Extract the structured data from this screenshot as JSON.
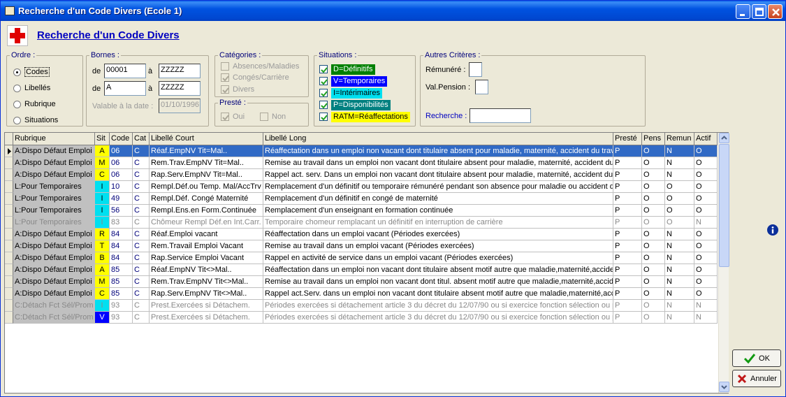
{
  "window": {
    "title": "Recherche d'un Code Divers (Ecole 1)"
  },
  "header": {
    "title": "Recherche d'un Code Divers"
  },
  "ordre": {
    "legend": "Ordre :",
    "options": [
      {
        "label": "Codes",
        "selected": true
      },
      {
        "label": "Libellés",
        "selected": false
      },
      {
        "label": "Rubrique",
        "selected": false
      },
      {
        "label": "Situations",
        "selected": false
      }
    ]
  },
  "bornes": {
    "legend": "Bornes :",
    "de_label": "de",
    "a_label": "à",
    "row1_from": "00001",
    "row1_to": "ZZZZZ",
    "row2_from": "A",
    "row2_to": "ZZZZZ",
    "valable_label": "Valable à la date :",
    "valable_value": "01/10/1996"
  },
  "categories": {
    "legend": "Catégories :",
    "items": [
      {
        "label": "Absences/Maladies",
        "checked": false
      },
      {
        "label": "Congés/Carrière",
        "checked": true
      },
      {
        "label": "Divers",
        "checked": true
      }
    ]
  },
  "preste": {
    "legend": "Presté :",
    "oui": "Oui",
    "non": "Non"
  },
  "situations": {
    "legend": "Situations :",
    "items": [
      {
        "label": "D=Définitifs",
        "bg": "#008000",
        "fg": "#ffffff"
      },
      {
        "label": "V=Temporaires",
        "bg": "#0000ff",
        "fg": "#ffffff"
      },
      {
        "label": "I=Intérimaires",
        "bg": "#00e0f0",
        "fg": "#000000"
      },
      {
        "label": "P=Disponibilités",
        "bg": "#008080",
        "fg": "#ffffff"
      },
      {
        "label": "RATM=Réaffectations",
        "bg": "#ffff00",
        "fg": "#000000"
      }
    ]
  },
  "autres": {
    "legend": "Autres Critères :",
    "remunere_label": "Rémunéré :",
    "valpension_label": "Val.Pension :",
    "recherche_label": "Recherche :"
  },
  "grid": {
    "columns": [
      "Rubrique",
      "Sit",
      "Code",
      "Cat",
      "Libellé Court",
      "Libellé Long",
      "Presté",
      "Pens",
      "Remun",
      "Actif"
    ],
    "rows": [
      {
        "rubrique": "A:Dispo Défaut Emploi",
        "sit": "A",
        "code": "06",
        "cat": "C",
        "court": "Réaf.EmpNV Tit=Mal..",
        "long": "Réaffectation dans un emploi non vacant dont titulaire absent pour maladie, maternité, accident du travail",
        "preste": "P",
        "pens": "O",
        "remun": "N",
        "actif": "O",
        "sit_color": "#ffff00",
        "selected": true,
        "gray": false
      },
      {
        "rubrique": "A:Dispo Défaut Emploi",
        "sit": "M",
        "code": "06",
        "cat": "C",
        "court": "Rem.Trav.EmpNV Tit=Mal..",
        "long": "Remise au travail dans un emploi non vacant dont titulaire absent pour maladie, maternité, accident du travail",
        "preste": "P",
        "pens": "O",
        "remun": "N",
        "actif": "O",
        "sit_color": "#ffff00",
        "selected": false,
        "gray": false
      },
      {
        "rubrique": "A:Dispo Défaut Emploi",
        "sit": "C",
        "code": "06",
        "cat": "C",
        "court": "Rap.Serv.EmpNV Tit=Mal..",
        "long": "Rappel act. serv. Dans un emploi non vacant dont titulaire absent pour maladie, maternité, accident du travail",
        "preste": "P",
        "pens": "O",
        "remun": "N",
        "actif": "O",
        "sit_color": "#ffff00",
        "selected": false,
        "gray": false
      },
      {
        "rubrique": "L:Pour Temporaires",
        "sit": "I",
        "code": "10",
        "cat": "C",
        "court": "Rempl.Déf.ou Temp. Mal/AccTrv",
        "long": "Remplacement d'un définitif ou temporaire rémunéré pendant son absence pour maladie ou accident de travail",
        "preste": "P",
        "pens": "O",
        "remun": "O",
        "actif": "O",
        "sit_color": "#00e0f0",
        "selected": false,
        "gray": false
      },
      {
        "rubrique": "L:Pour Temporaires",
        "sit": "I",
        "code": "49",
        "cat": "C",
        "court": "Rempl.Déf. Congé Maternité",
        "long": "Remplacement d'un définitif en congé de maternité",
        "preste": "P",
        "pens": "O",
        "remun": "O",
        "actif": "O",
        "sit_color": "#00e0f0",
        "selected": false,
        "gray": false
      },
      {
        "rubrique": "L:Pour Temporaires",
        "sit": "I",
        "code": "56",
        "cat": "C",
        "court": "Rempl.Ens.en Form.Continuée",
        "long": "Remplacement d'un enseignant en formation continuée",
        "preste": "P",
        "pens": "O",
        "remun": "O",
        "actif": "O",
        "sit_color": "#00e0f0",
        "selected": false,
        "gray": false
      },
      {
        "rubrique": "L:Pour Temporaires",
        "sit": "I",
        "code": "83",
        "cat": "C",
        "court": "Chômeur Rempl Déf.en Int.Carr.",
        "long": "Temporaire chomeur remplacant un définitif en interruption de carrière",
        "preste": "P",
        "pens": "O",
        "remun": "O",
        "actif": "N",
        "sit_color": "#00e0f0",
        "selected": false,
        "gray": true
      },
      {
        "rubrique": "A:Dispo Défaut Emploi",
        "sit": "R",
        "code": "84",
        "cat": "C",
        "court": "Réaf.Emploi vacant",
        "long": "Réaffectation dans un emploi vacant (Périodes exercées)",
        "preste": "P",
        "pens": "O",
        "remun": "N",
        "actif": "O",
        "sit_color": "#ffff00",
        "selected": false,
        "gray": false
      },
      {
        "rubrique": "A:Dispo Défaut Emploi",
        "sit": "T",
        "code": "84",
        "cat": "C",
        "court": "Rem.Travail Emploi Vacant",
        "long": "Remise au travail dans un emploi vacant (Périodes exercées)",
        "preste": "P",
        "pens": "O",
        "remun": "N",
        "actif": "O",
        "sit_color": "#ffff00",
        "selected": false,
        "gray": false
      },
      {
        "rubrique": "A:Dispo Défaut Emploi",
        "sit": "B",
        "code": "84",
        "cat": "C",
        "court": "Rap.Service Emploi Vacant",
        "long": "Rappel en activité de service dans un emploi vacant (Périodes exercées)",
        "preste": "P",
        "pens": "O",
        "remun": "N",
        "actif": "O",
        "sit_color": "#ffff00",
        "selected": false,
        "gray": false
      },
      {
        "rubrique": "A:Dispo Défaut Emploi",
        "sit": "A",
        "code": "85",
        "cat": "C",
        "court": "Réaf.EmpNV Tit<>Mal..",
        "long": "Réaffectation dans un emploi non vacant dont titulaire absent  motif autre que maladie,maternité,accident du travail",
        "preste": "P",
        "pens": "O",
        "remun": "N",
        "actif": "O",
        "sit_color": "#ffff00",
        "selected": false,
        "gray": false
      },
      {
        "rubrique": "A:Dispo Défaut Emploi",
        "sit": "M",
        "code": "85",
        "cat": "C",
        "court": "Rem.Trav.EmpNV Tit<>Mal..",
        "long": "Remise au travail dans un emploi non vacant dont titul. absent motif autre que maladie,maternité,accident du travail",
        "preste": "P",
        "pens": "O",
        "remun": "N",
        "actif": "O",
        "sit_color": "#ffff00",
        "selected": false,
        "gray": false
      },
      {
        "rubrique": "A:Dispo Défaut Emploi",
        "sit": "C",
        "code": "85",
        "cat": "C",
        "court": "Rap.Serv.EmpNV Tit<>Mal..",
        "long": "Rappel act.Serv. dans un emploi non vacant dont titulaire absent motif autre que maladie,maternité,accident du travail",
        "preste": "P",
        "pens": "O",
        "remun": "N",
        "actif": "O",
        "sit_color": "#ffff00",
        "selected": false,
        "gray": false
      },
      {
        "rubrique": "C:Détach Fct Sél/Prom",
        "sit": "I",
        "code": "93",
        "cat": "C",
        "court": "Prest.Exercées si Détachem.",
        "long": "Périodes exercées si détachement article 3 du décret du 12/07/90 ou si exercice fonction sélection ou promotion",
        "preste": "P",
        "pens": "O",
        "remun": "N",
        "actif": "N",
        "sit_color": "#00e0f0",
        "selected": false,
        "gray": true
      },
      {
        "rubrique": "C:Détach Fct Sél/Prom",
        "sit": "V",
        "code": "93",
        "cat": "C",
        "court": "Prest.Exercées si Détachem.",
        "long": "Périodes exercées si détachement article 3 du décret du 12/07/90 ou si exercice fonction sélection ou promotion",
        "preste": "P",
        "pens": "O",
        "remun": "N",
        "actif": "N",
        "sit_color": "#0000ff",
        "selected": false,
        "gray": true
      }
    ]
  },
  "buttons": {
    "ok": "OK",
    "annuler": "Annuler"
  },
  "colors": {
    "rubrique_bg": "#c0c0c0",
    "selection": "#316ac5",
    "title_link": "#0000c0"
  }
}
